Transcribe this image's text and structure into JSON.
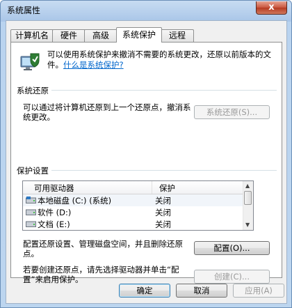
{
  "window": {
    "title": "系统属性",
    "close_label": "x"
  },
  "tabs": [
    "计算机名",
    "硬件",
    "高级",
    "系统保护",
    "远程"
  ],
  "intro": {
    "text": "可以使用系统保护来撤消不需要的系统更改，还原以前版本的文件。",
    "link": "什么是系统保护?"
  },
  "restore": {
    "group": "系统还原",
    "desc": "可以通过将计算机还原到上一个还原点，撤消系统更改。",
    "button": "系统还原(S)..."
  },
  "protection": {
    "group": "保护设置",
    "columns": [
      "可用驱动器",
      "保护"
    ],
    "rows": [
      {
        "drive": "本地磁盘 (C:) (系统)",
        "status": "关闭"
      },
      {
        "drive": "软件 (D:)",
        "status": "关闭"
      },
      {
        "drive": "文档 (E:)",
        "status": "关闭"
      }
    ],
    "config_desc": "配置还原设置、管理磁盘空间，并且删除还原点。",
    "config_button": "配置(O)...",
    "create_desc": "若要创建还原点，请先选择驱动器并单击“配置”来启用保护。",
    "create_button": "创建(C)..."
  },
  "footer": {
    "ok": "确定",
    "cancel": "取消",
    "apply": "应用(A)"
  }
}
